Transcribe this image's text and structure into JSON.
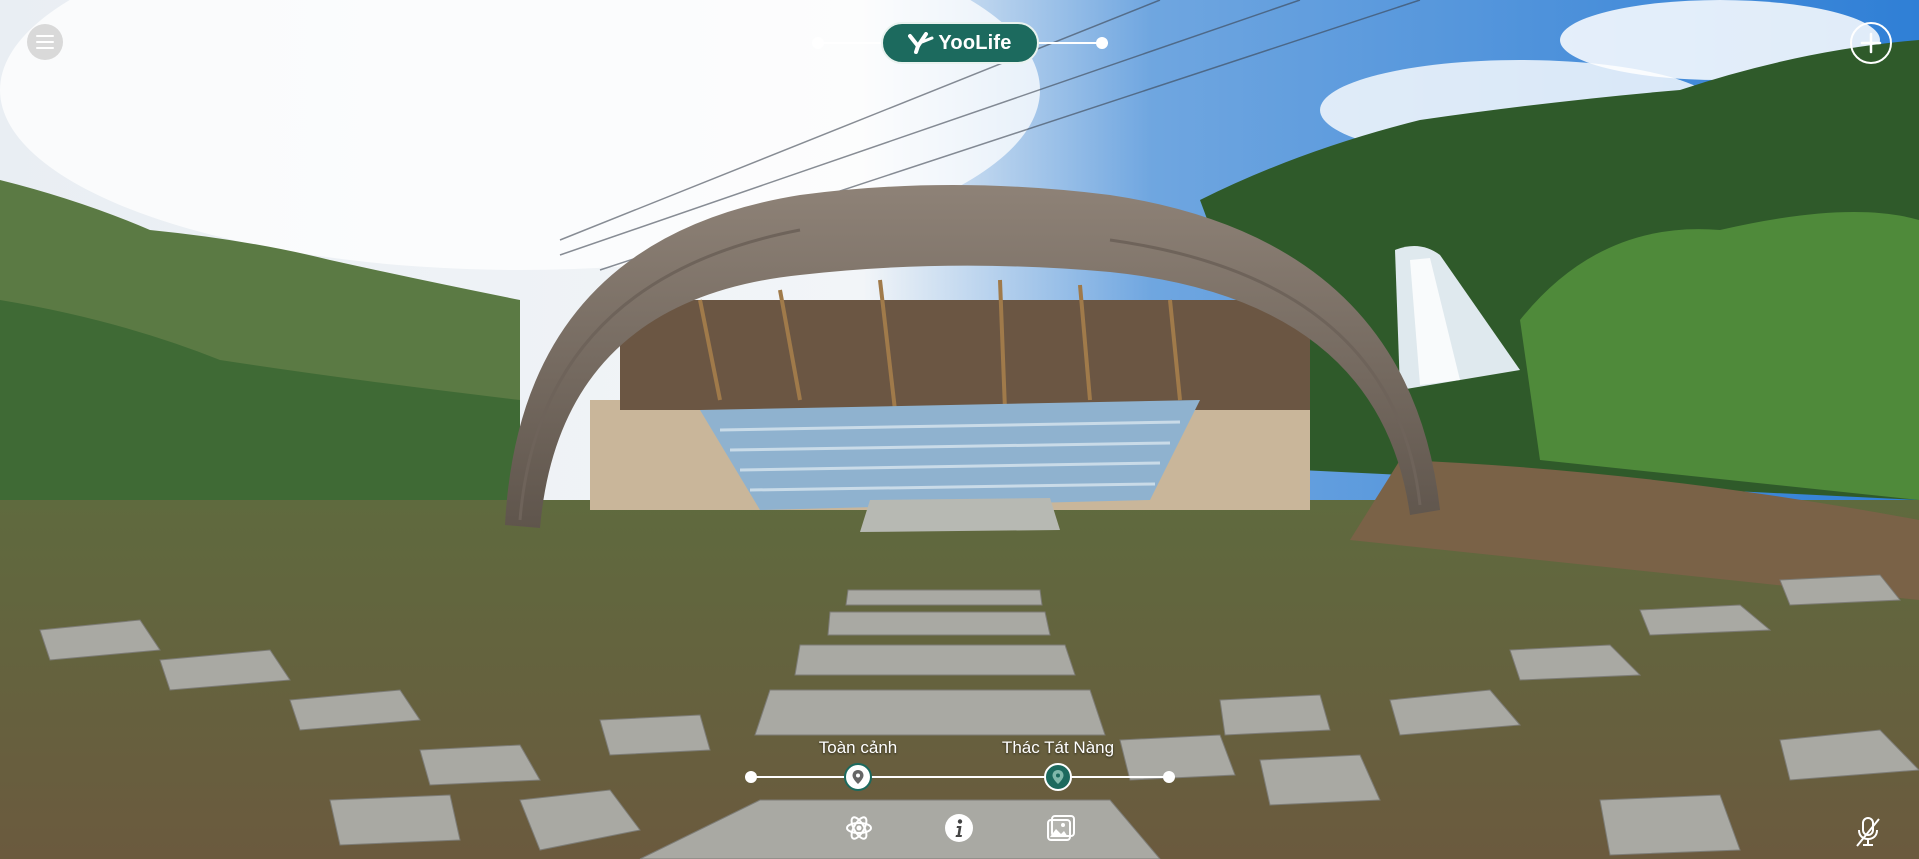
{
  "brand": {
    "logo_text": "YooLife",
    "accent": "#1c6a5e"
  },
  "top": {
    "menu_icon": "hamburger-menu-icon",
    "add_icon": "plus-circle-icon"
  },
  "timeline": {
    "points": [
      {
        "label": "Toàn cảnh",
        "icon": "location-pin-icon",
        "active": false
      },
      {
        "label": "Thác Tát Nàng",
        "icon": "location-pin-icon",
        "active": true
      }
    ]
  },
  "toolbar": {
    "items": [
      {
        "icon": "atom-icon"
      },
      {
        "icon": "info-icon"
      },
      {
        "icon": "gallery-icon"
      }
    ],
    "mic_icon": "microphone-off-icon"
  }
}
